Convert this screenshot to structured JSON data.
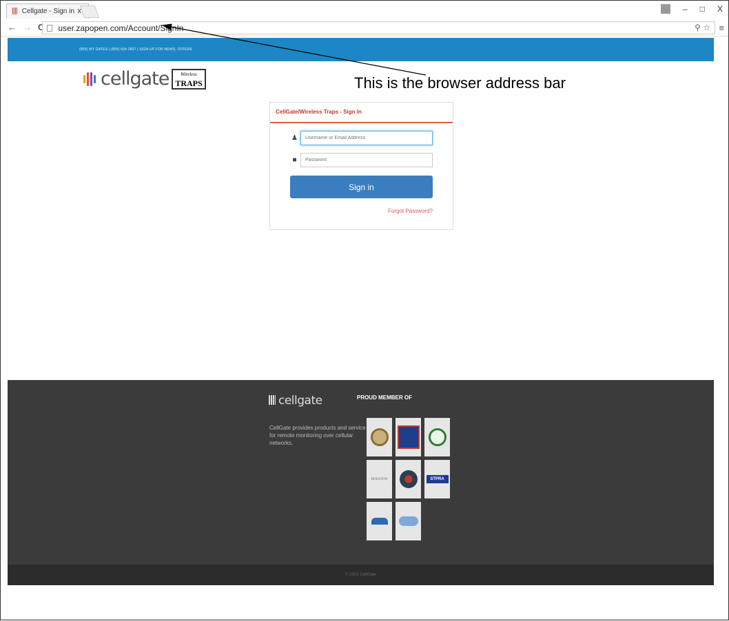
{
  "browser": {
    "tab_title": "Cellgate - Sign in",
    "tab_close": "x",
    "url": "user.zapopen.com/Account/SignIn",
    "window_controls": [
      "–",
      "□",
      "X"
    ]
  },
  "site": {
    "topbar_text": "(855) MY GATES | (855) 694 2837 | SIGN UP FOR NEWS, OFFERS",
    "logo_word": "cellgate",
    "logo_traps_small": "Wireless",
    "logo_traps": "TRAPS"
  },
  "annotation": {
    "text": "This is the browser address bar"
  },
  "login": {
    "title": "CellGate/Wireless Traps - Sign In",
    "username_placeholder": "Username or Email Address",
    "password_placeholder": "Password",
    "signin_label": "Sign in",
    "forgot_label": "Forgot Password?"
  },
  "footer": {
    "logo_word": "cellgate",
    "description": "CellGate provides products and service for remote monitoring over cellular networks.",
    "member_heading": "PROUD MEMBER OF",
    "copyright": "© 2015 CellGate"
  },
  "colors": {
    "brand_blue": "#1d87c6",
    "signin_button": "#3a7ebf",
    "accent_red": "#c0392b",
    "footer_bg": "#3b3b3b"
  }
}
